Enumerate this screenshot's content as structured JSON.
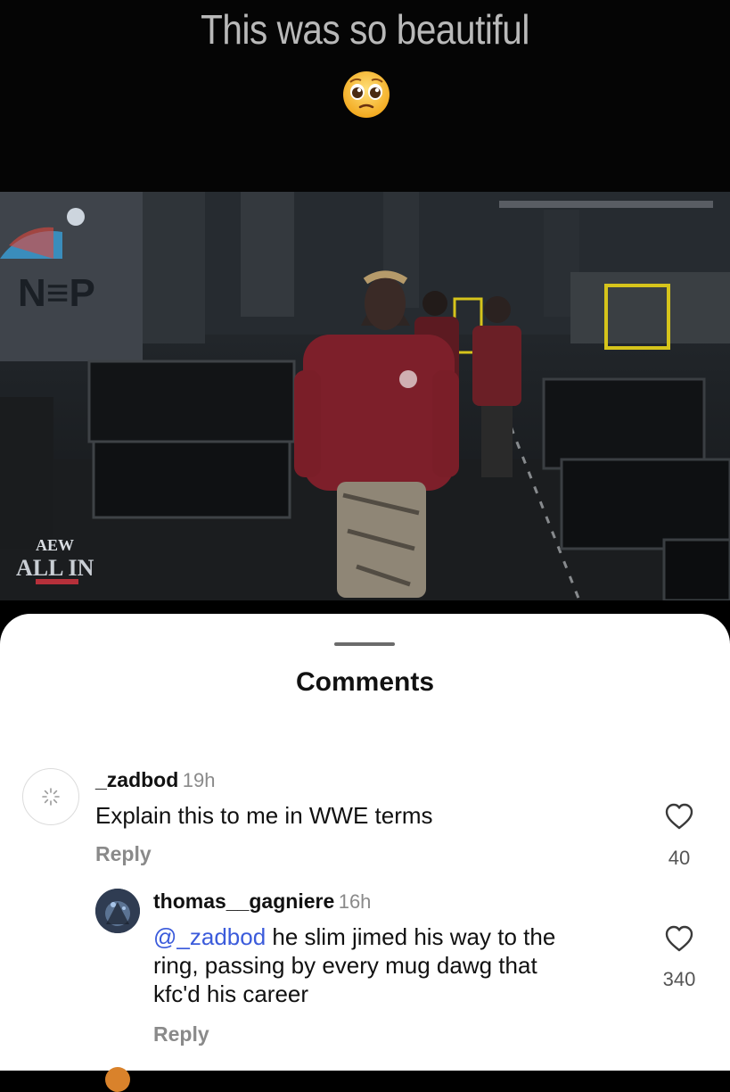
{
  "story": {
    "caption": "This was so beautiful",
    "emoji": "pleading-face-emoji"
  },
  "video": {
    "watermark_brand": "AEW",
    "watermark_event": "ALL IN",
    "banner_text": "N≡P"
  },
  "comments_sheet": {
    "title": "Comments",
    "comments": [
      {
        "username": "_zadbod",
        "time": "19h",
        "text": "Explain this to me in WWE terms",
        "reply_label": "Reply",
        "likes": "40"
      },
      {
        "username": "thomas__gagniere",
        "time": "16h",
        "mention": "@_zadbod",
        "text_line1": " he slim jimed his way to the",
        "text_line2": "ring, passing by every mug dawg that",
        "text_line3": "kfc'd his career",
        "reply_label": "Reply",
        "likes": "340"
      }
    ]
  }
}
